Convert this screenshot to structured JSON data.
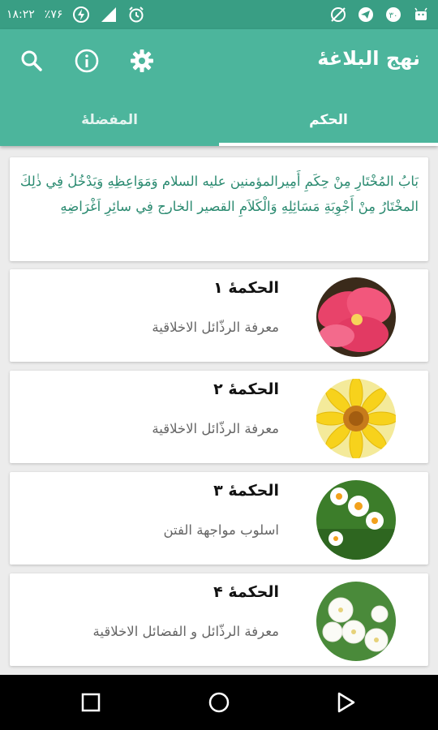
{
  "status_bar": {
    "time": "١٨:٢٢",
    "extra": "٪٧۶"
  },
  "app": {
    "title": "نهج البلاغۀ"
  },
  "actions": {
    "search_icon": "search-icon",
    "info_icon": "info-icon",
    "settings_icon": "gear-icon"
  },
  "tabs": [
    {
      "label": "الحکم",
      "active": true
    },
    {
      "label": "المفضلۀ",
      "active": false
    }
  ],
  "intro": {
    "text": "بَابُ المُخْتَارِ مِنْ حِكَمِ أَمِيرالمؤمنين عليه السلام وَمَوَاعِظِهِ وَيَدْخُلُ فِي ذٰلِكَ المخْتَارُ مِنْ أَجْوِبَةِ مَسَائِلِهِ وَالْكَلاَمِ القصير الخارج فِي سائِرِ اَغْرَاضِهِ"
  },
  "items": [
    {
      "title": "الحکمۀ ١",
      "subtitle": "معرفة الرذّائل الاخلاقية",
      "image": "pink-flower"
    },
    {
      "title": "الحکمۀ ٢",
      "subtitle": "معرفة الرذّائل الاخلاقية",
      "image": "yellow-flower"
    },
    {
      "title": "الحکمۀ ٣",
      "subtitle": "اسلوب مواجهة الفتن",
      "image": "narcissus-flower"
    },
    {
      "title": "الحکمۀ ۴",
      "subtitle": "معرفة الرذّائل و الفضائل الاخلاقية",
      "image": "white-flower"
    }
  ],
  "colors": {
    "status_bar": "#399e84",
    "app_bar": "#4cb59c",
    "intro_text": "#2a8a70"
  }
}
